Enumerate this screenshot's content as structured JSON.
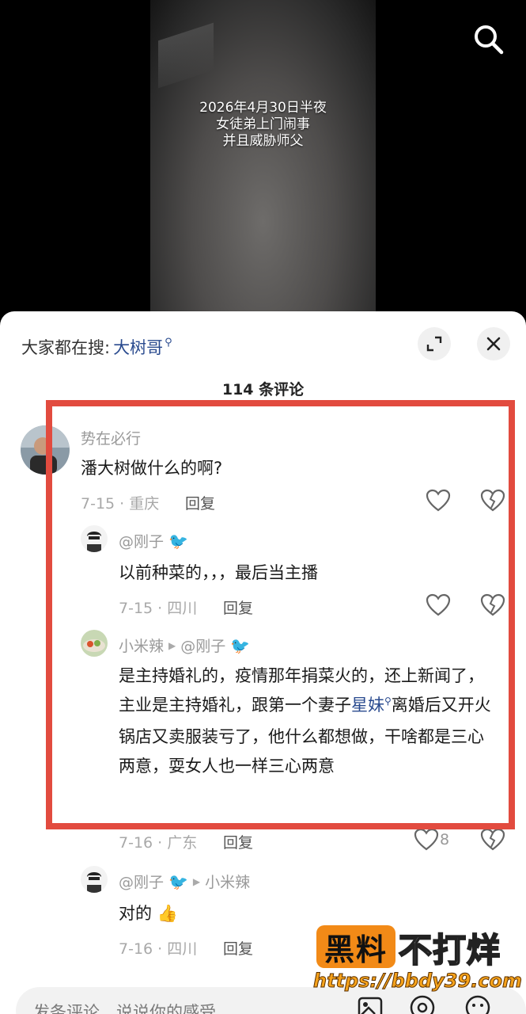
{
  "video": {
    "caption": [
      "2026年4月30日半夜",
      "女徒弟上门闹事",
      "并且威胁师父"
    ]
  },
  "search": {
    "prefix": "大家都在搜:",
    "keyword": "大树哥"
  },
  "comments_title": "114 条评论",
  "comments": [
    {
      "username": "势在必行",
      "text": "潘大树做什么的啊?",
      "date_location": "7-15 · 重庆",
      "reply_label": "回复"
    }
  ],
  "replies": [
    {
      "username": "@刚子",
      "text": "以前种菜的，，，最后当主播",
      "date_location": "7-15 · 四川",
      "reply_label": "回复"
    },
    {
      "username": "小米辣",
      "reply_to": "@刚子",
      "text_before": "是主持婚礼的，疫情那年捐菜火的，还上新闻了，主业是主持婚礼，跟第一个妻子",
      "keyword": "星妹",
      "text_after": "离婚后又开火锅店又卖服装亏了，他什么都想做，干啥都是三心两意，耍女人也一样三心两意",
      "date_location": "7-16 · 广东",
      "reply_label": "回复",
      "like_count": "8"
    },
    {
      "username": "@刚子",
      "reply_to": "小米辣",
      "text": "对的",
      "date_location": "7-16 · 四川",
      "reply_label": "回复"
    }
  ],
  "input": {
    "placeholder": "发条评论，说说你的感受"
  },
  "watermark": {
    "badge": "黑料",
    "text": "不打烊",
    "url": "https://bbdy39.com"
  },
  "colors": {
    "highlight": "#e24b3f",
    "keyword": "#2a4b8f",
    "watermark_orange": "#f28a17"
  }
}
